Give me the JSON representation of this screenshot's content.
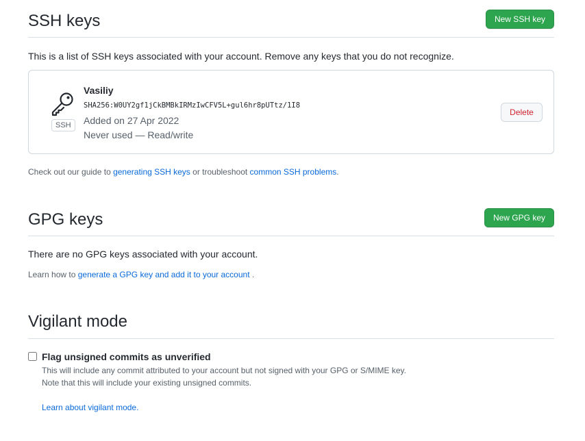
{
  "ssh": {
    "title": "SSH keys",
    "new_button": "New SSH key",
    "intro": "This is a list of SSH keys associated with your account. Remove any keys that you do not recognize.",
    "key": {
      "name": "Vasiliy",
      "fingerprint": "SHA256:W0UY2gf1jCkBMBkIRMzIwCFV5L+gul6hr8pUTtz/1I8",
      "badge": "SSH",
      "added": "Added on 27 Apr 2022",
      "usage": "Never used — Read/write",
      "delete_button": "Delete",
      "icon": "key-icon"
    },
    "footer_prefix": "Check out our guide to ",
    "footer_link1": "generating SSH keys",
    "footer_middle": " or troubleshoot ",
    "footer_link2": "common SSH problems",
    "footer_suffix": "."
  },
  "gpg": {
    "title": "GPG keys",
    "new_button": "New GPG key",
    "empty_text": "There are no GPG keys associated with your account.",
    "learn_prefix": "Learn how to ",
    "learn_link": "generate a GPG key and add it to your account",
    "learn_suffix": " ."
  },
  "vigilant": {
    "title": "Vigilant mode",
    "checkbox_label": "Flag unsigned commits as unverified",
    "checked": false,
    "desc_line1": "This will include any commit attributed to your account but not signed with your GPG or S/MIME key.",
    "desc_line2": "Note that this will include your existing unsigned commits.",
    "learn_link": "Learn about vigilant mode."
  },
  "colors": {
    "primary_button": "#2da44e",
    "link": "#0969da",
    "danger": "#cf222e",
    "border": "#d0d7de",
    "muted_text": "#57606a"
  }
}
